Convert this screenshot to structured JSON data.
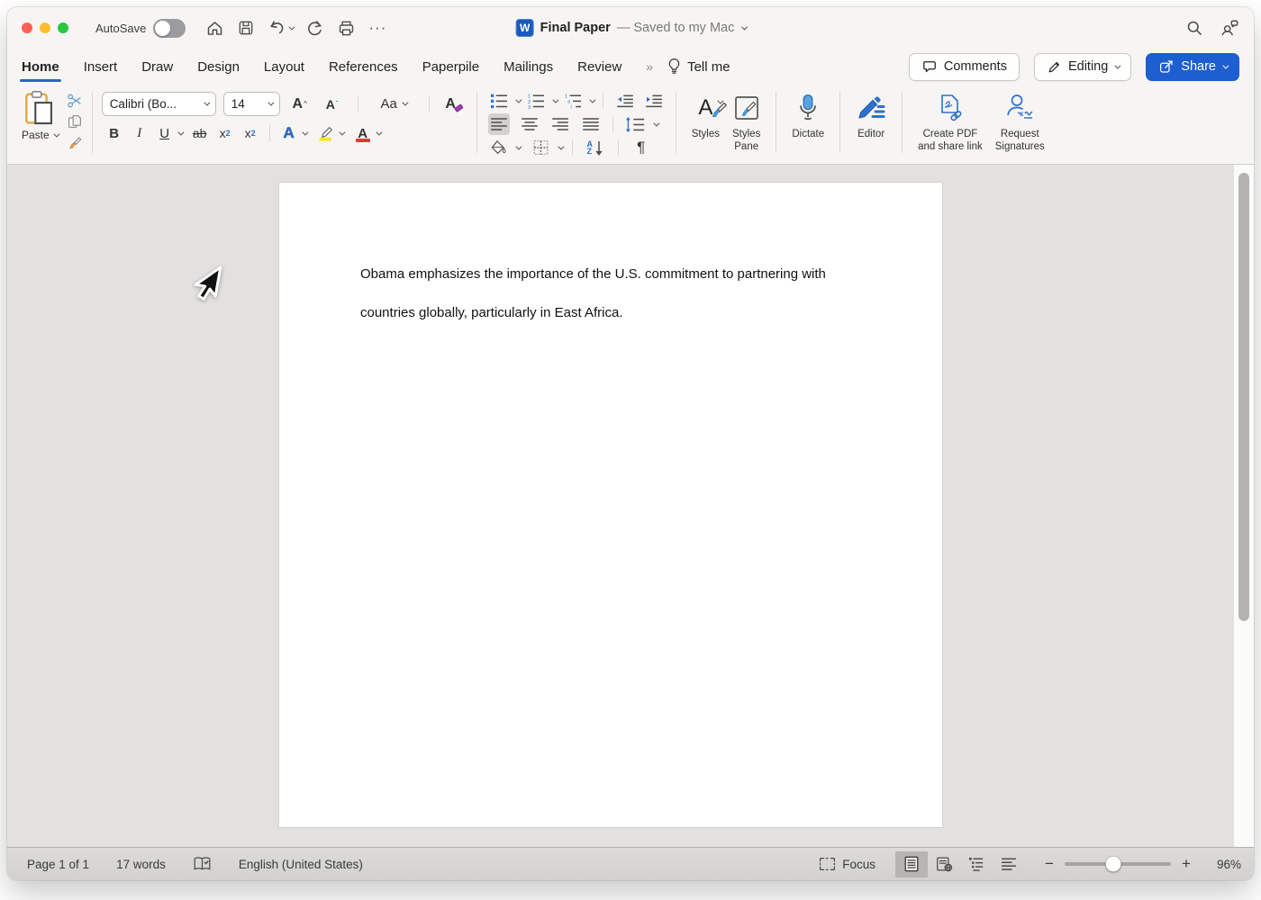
{
  "window": {
    "autosave_label": "AutoSave",
    "title": "Final Paper",
    "title_suffix": "— Saved to my Mac",
    "more_actions_glyph": "···"
  },
  "tabs": [
    "Home",
    "Insert",
    "Draw",
    "Design",
    "Layout",
    "References",
    "Paperpile",
    "Mailings",
    "Review"
  ],
  "tabs_overflow_glyph": "»",
  "tell_me_label": "Tell me",
  "top_actions": {
    "comments": "Comments",
    "editing": "Editing",
    "share": "Share"
  },
  "ribbon": {
    "paste_label": "Paste",
    "font_name": "Calibri (Bo...",
    "font_size": "14",
    "grow_font_glyph": "A",
    "shrink_font_glyph": "A",
    "change_case_glyph": "Aa",
    "clear_format_glyph": "A",
    "bold_glyph": "B",
    "italic_glyph": "I",
    "underline_glyph": "U",
    "strikethrough_glyph": "ab",
    "subscript_base": "x",
    "subscript_script": "2",
    "superscript_base": "x",
    "superscript_script": "2",
    "text_effects_glyph": "A",
    "font_color_glyph": "A",
    "pilcrow_glyph": "¶",
    "sort_a": "A",
    "sort_z": "Z",
    "styles_label": "Styles",
    "styles_pane_label": "Styles\nPane",
    "dictate_label": "Dictate",
    "editor_label": "Editor",
    "create_pdf_label": "Create PDF\nand share link",
    "request_signatures_label": "Request\nSignatures"
  },
  "document": {
    "line1": "Obama emphasizes the importance of the U.S. commitment to partnering with",
    "line2": "countries globally, particularly in East Africa."
  },
  "status_bar": {
    "page_info": "Page 1 of 1",
    "word_count": "17 words",
    "language": "English (United States)",
    "focus_label": "Focus",
    "zoom_level": "96%",
    "zoom_out_glyph": "−",
    "zoom_in_glyph": "+"
  },
  "colors": {
    "accent_blue": "#2b63c4",
    "share_button_blue": "#1d5ed1",
    "word_brand_blue": "#185abd",
    "icon_blue": "#2f6fce",
    "highlight_yellow": "#f7e432",
    "font_color_red": "#e03a30",
    "traffic_red": "#ff5f57",
    "traffic_yellow": "#febc2e",
    "traffic_green": "#28c840"
  }
}
